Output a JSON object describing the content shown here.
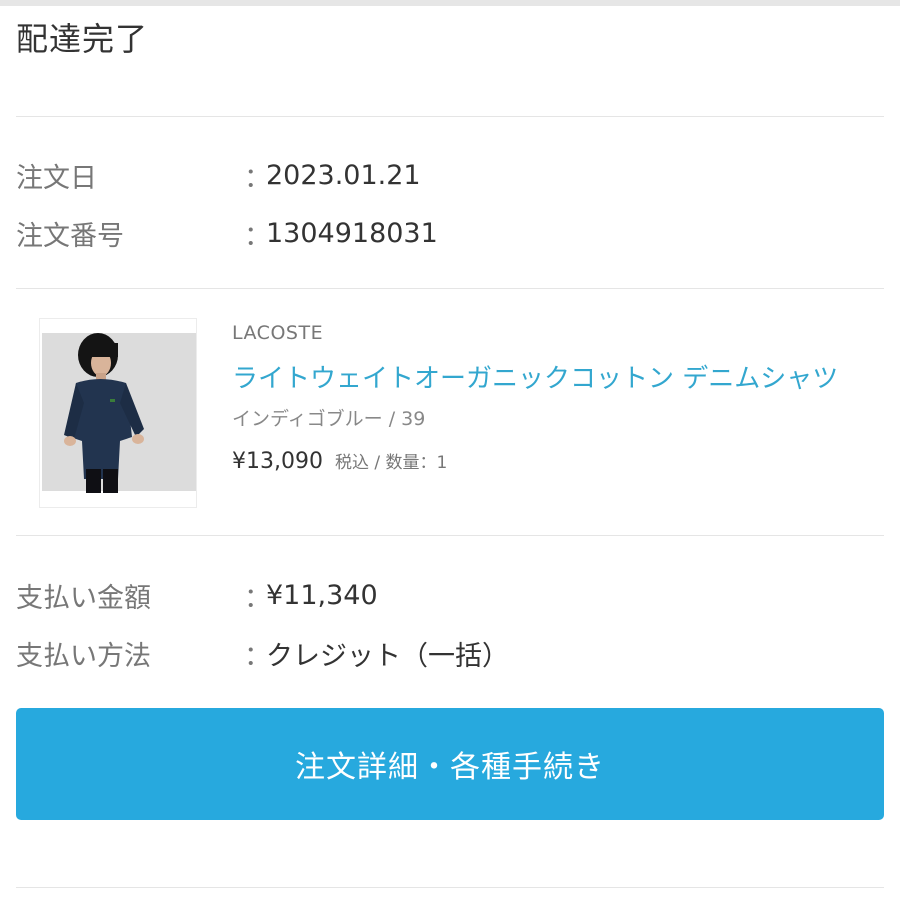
{
  "order": {
    "status": "配達完了",
    "date_label": "注文日",
    "date_value": "2023.01.21",
    "number_label": "注文番号",
    "number_value": "1304918031",
    "separator": "："
  },
  "product": {
    "brand": "LACOSTE",
    "name": "ライトウェイトオーガニックコットン デニムシャツ",
    "variant": "インディゴブルー / 39",
    "price": "¥13,090",
    "price_note": "税込 / 数量：1",
    "link_color": "#33a7cf"
  },
  "payment": {
    "amount_label": "支払い金額",
    "amount_value": "¥11,340",
    "method_label": "支払い方法",
    "method_value": "クレジット（一括）"
  },
  "actions": {
    "details_button": "注文詳細・各種手続き",
    "button_color": "#27a9de"
  }
}
